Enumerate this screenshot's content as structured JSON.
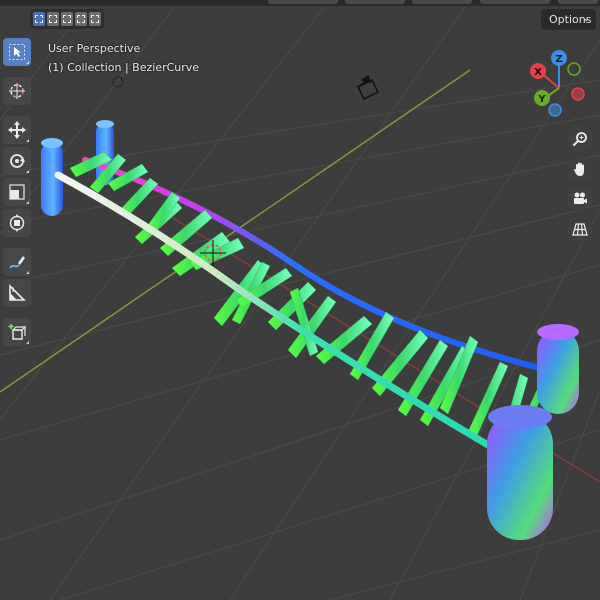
{
  "header": {
    "options_label": "Options",
    "select_modes": [
      "select-box",
      "extend",
      "subtract",
      "invert",
      "intersect"
    ]
  },
  "viewport": {
    "view_name": "User Perspective",
    "collection_line": "(1) Collection | BezierCurve"
  },
  "toolbar": {
    "tools": [
      "select-box",
      "cursor",
      "move",
      "rotate",
      "scale",
      "transform",
      "annotate",
      "measure",
      "add-cube"
    ],
    "active_tool": "select-box"
  },
  "navigation_gizmo": {
    "axes": [
      "X",
      "Y",
      "Z"
    ],
    "colors": {
      "x": "#e2414b",
      "y": "#6ca82a",
      "z": "#3d8de0"
    }
  },
  "nav_buttons": [
    "zoom",
    "pan",
    "camera-view",
    "toggle-perspective"
  ],
  "scene": {
    "object": "BezierCurve",
    "background": "#3d3d3d",
    "grid_color": "#4a4a4a",
    "axis_colors": {
      "x": "#9b3a3a",
      "y": "#7f9a3a"
    }
  }
}
